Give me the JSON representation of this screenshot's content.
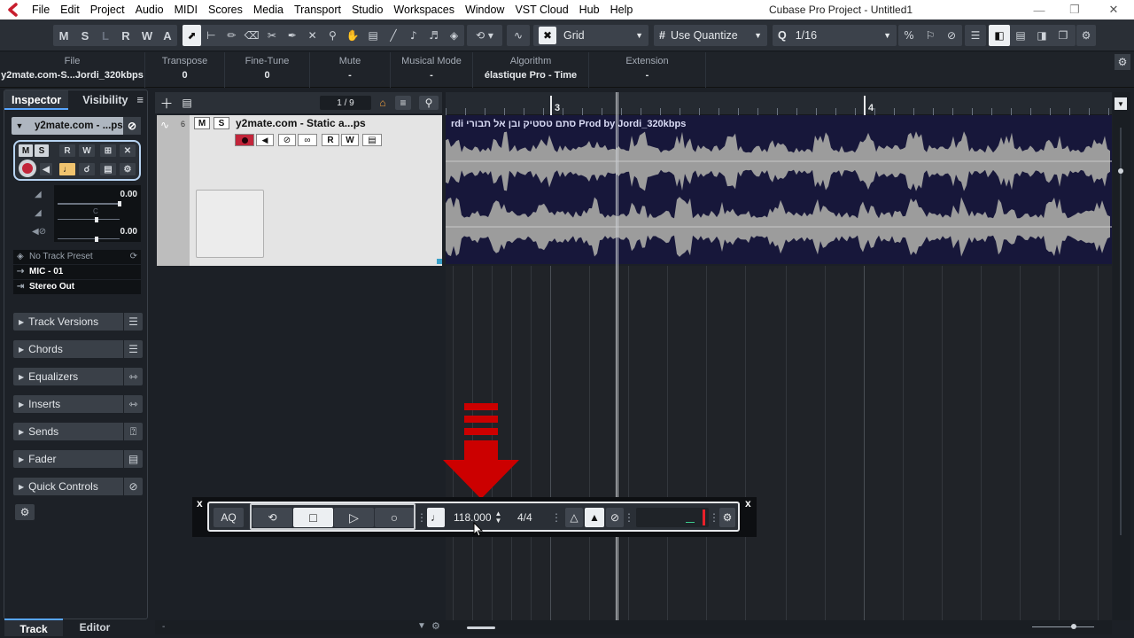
{
  "menubar": {
    "items": [
      "File",
      "Edit",
      "Project",
      "Audio",
      "MIDI",
      "Scores",
      "Media",
      "Transport",
      "Studio",
      "Workspaces",
      "Window",
      "VST Cloud",
      "Hub",
      "Help"
    ],
    "window_title": "Cubase Pro Project - Untitled1"
  },
  "toolbar": {
    "mode_buttons": [
      "M",
      "S",
      "L",
      "R",
      "W",
      "A"
    ],
    "snap_type": "Grid",
    "quantize_mode": "Use Quantize",
    "quantize_value": "1/16"
  },
  "infoline": {
    "columns": [
      {
        "header": "File",
        "value": "y2mate.com-S...Jordi_320kbps"
      },
      {
        "header": "Transpose",
        "value": "0"
      },
      {
        "header": "Fine-Tune",
        "value": "0"
      },
      {
        "header": "Mute",
        "value": "-"
      },
      {
        "header": "Musical Mode",
        "value": "-"
      },
      {
        "header": "Algorithm",
        "value": "élastique Pro - Time"
      },
      {
        "header": "Extension",
        "value": "-"
      }
    ]
  },
  "inspector": {
    "tabs": [
      "Inspector",
      "Visibility"
    ],
    "track_name": "y2mate.com - ...ps",
    "volume": "0.00",
    "pan_label": "C",
    "pan": "0.00",
    "preset": "No Track Preset",
    "input": "MIC - 01",
    "output": "Stereo Out",
    "sections": [
      "Track Versions",
      "Chords",
      "Equalizers",
      "Inserts",
      "Sends",
      "Fader",
      "Quick Controls"
    ],
    "bottom_tabs": [
      "Track",
      "Editor"
    ]
  },
  "project": {
    "track_count": "1 / 9",
    "track_number": "6",
    "track_title": "y2mate.com - Static a...ps",
    "bar_labels": [
      "3",
      "4"
    ],
    "event_title": "rdi  סתם טסטיק ובן אל תבורי Prod by Jordi_320kbps"
  },
  "transport": {
    "tempo": "118.000",
    "signature": "4/4",
    "aq_label": "AQ"
  },
  "colors": {
    "accent": "#58a6ff",
    "record": "#c2253a",
    "arrow": "#cc0000",
    "waveform": "#9c9c9c",
    "event_bg": "#17173a"
  }
}
